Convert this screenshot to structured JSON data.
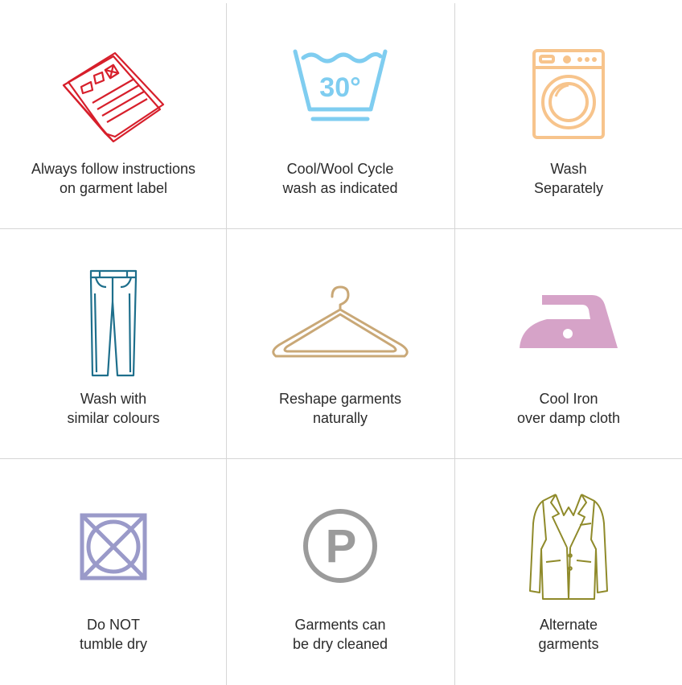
{
  "cells": [
    {
      "line1": "Always follow instructions",
      "line2": "on garment label",
      "icon": "garment-label-icon",
      "color": "#d71f2b"
    },
    {
      "line1": "Cool/Wool Cycle",
      "line2": "wash as indicated",
      "icon": "wash-30-icon",
      "color": "#7fcdf0",
      "icon_text": "30°"
    },
    {
      "line1": "Wash",
      "line2": "Separately",
      "icon": "washing-machine-icon",
      "color": "#f7c48c"
    },
    {
      "line1": "Wash with",
      "line2": "similar colours",
      "icon": "jeans-icon",
      "color": "#1e6f8c"
    },
    {
      "line1": "Reshape garments",
      "line2": "naturally",
      "icon": "hanger-icon",
      "color": "#c9a877"
    },
    {
      "line1": "Cool Iron",
      "line2": "over damp cloth",
      "icon": "iron-icon",
      "color": "#d6a3c8"
    },
    {
      "line1": "Do NOT",
      "line2": "tumble dry",
      "icon": "no-tumble-dry-icon",
      "color": "#9a9ac9"
    },
    {
      "line1": "Garments can",
      "line2": "be dry cleaned",
      "icon": "dry-clean-p-icon",
      "color": "#9b9b9b",
      "icon_text": "P"
    },
    {
      "line1": "Alternate",
      "line2": "garments",
      "icon": "jacket-icon",
      "color": "#8f8a2a"
    }
  ]
}
